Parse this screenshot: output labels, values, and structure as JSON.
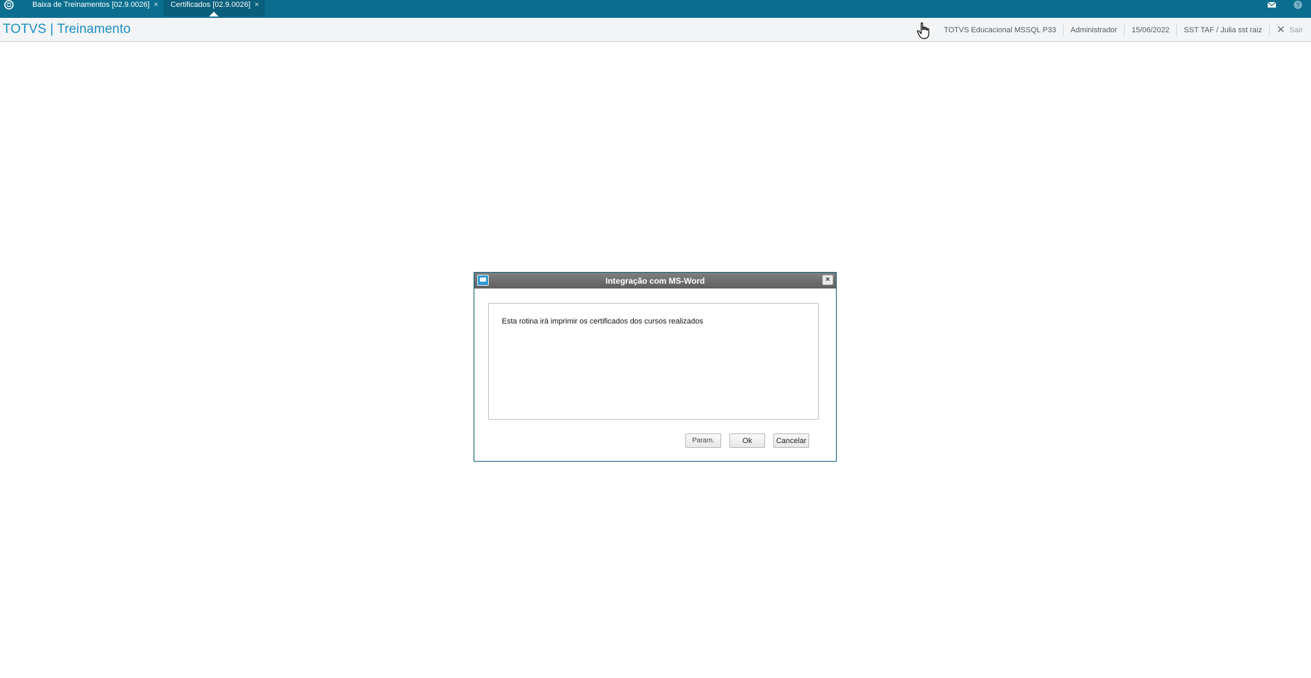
{
  "topbar": {
    "tabs": [
      {
        "label": "Baixa de Treinamentos [02.9.0026]",
        "close": "×"
      },
      {
        "label": "Certificados [02.9.0026]",
        "close": "×",
        "active": true
      }
    ],
    "icons": [
      "mail-icon",
      "help-icon"
    ]
  },
  "header": {
    "brand": "TOTVS | Treinamento",
    "environment": "TOTVS Educacional MSSQL P33",
    "user": "Administrador",
    "date": "15/06/2022",
    "company": "SST TAF / Julia sst raiz",
    "exit_symbol": "✕",
    "exit_label": "Sair"
  },
  "dialog": {
    "title": "Integração com MS-Word",
    "close": "×",
    "message": "Esta rotina irá imprimir os certificados dos cursos realizados",
    "buttons": {
      "param": "Param.",
      "ok": "Ok",
      "cancel": "Cancelar"
    }
  },
  "colors": {
    "topbar": "#0b6e8f",
    "brand": "#1a8fc1",
    "dialog_title": "#6f6f6f"
  }
}
